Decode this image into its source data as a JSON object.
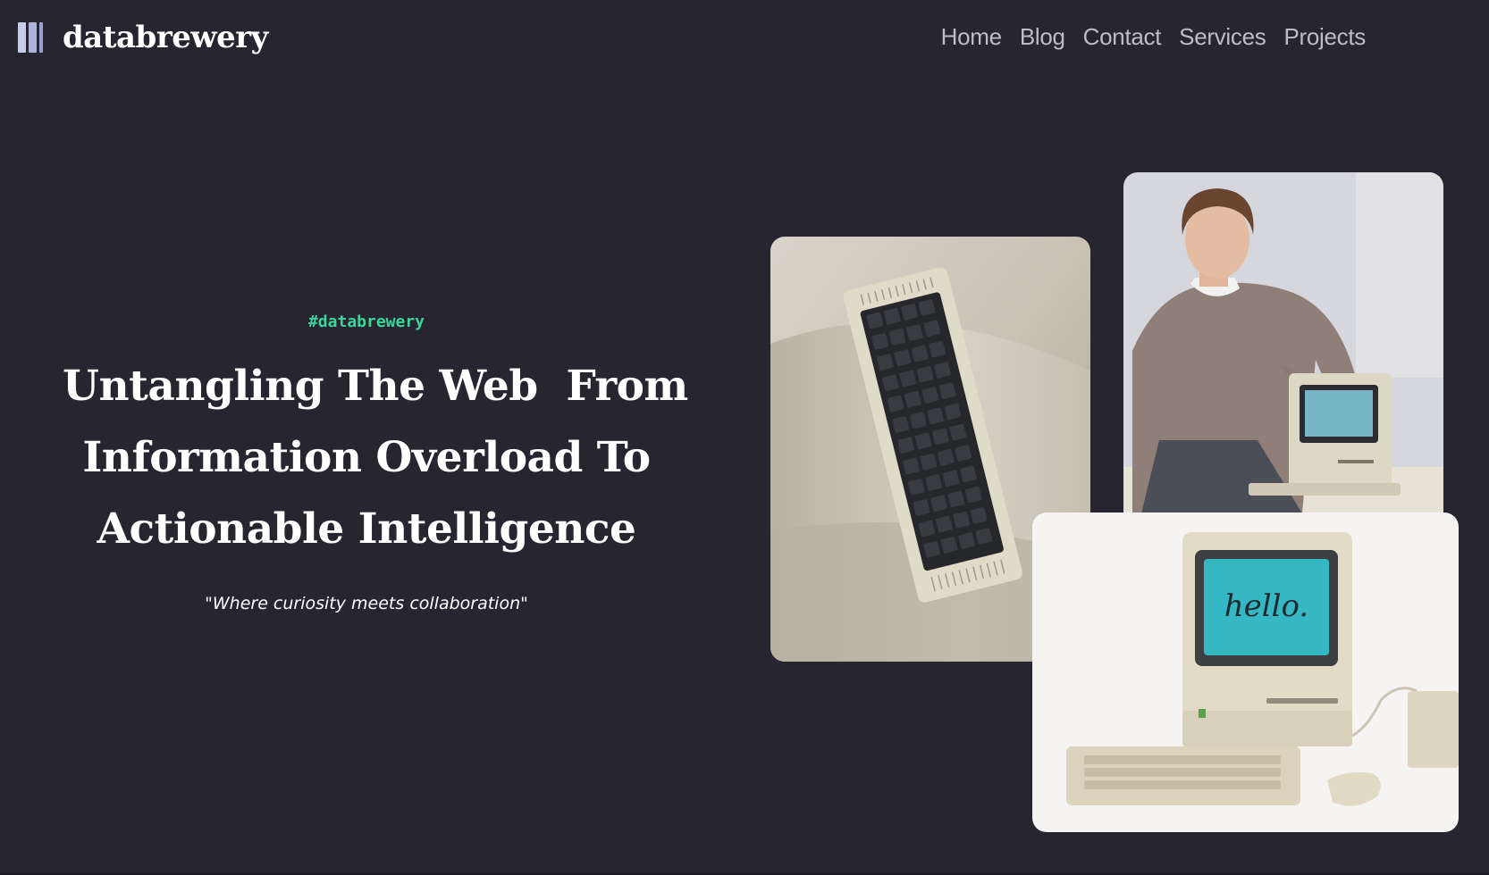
{
  "header": {
    "logo_text": "databrewery",
    "logo_icon": "book-columns-icon",
    "nav": [
      "Home",
      "Blog",
      "Contact",
      "Services",
      "Projects"
    ]
  },
  "hero": {
    "hashtag": "#databrewery",
    "headline_lines": [
      "Untangling The Web  From",
      "Information Overload To",
      "Actionable Intelligence"
    ],
    "tagline": "\"Where curiosity meets collaboration\""
  },
  "photos": {
    "screen_text": "hello."
  },
  "colors": {
    "background": "#262530",
    "accent": "#3ad69a",
    "nav_text": "#bdbdc3"
  }
}
